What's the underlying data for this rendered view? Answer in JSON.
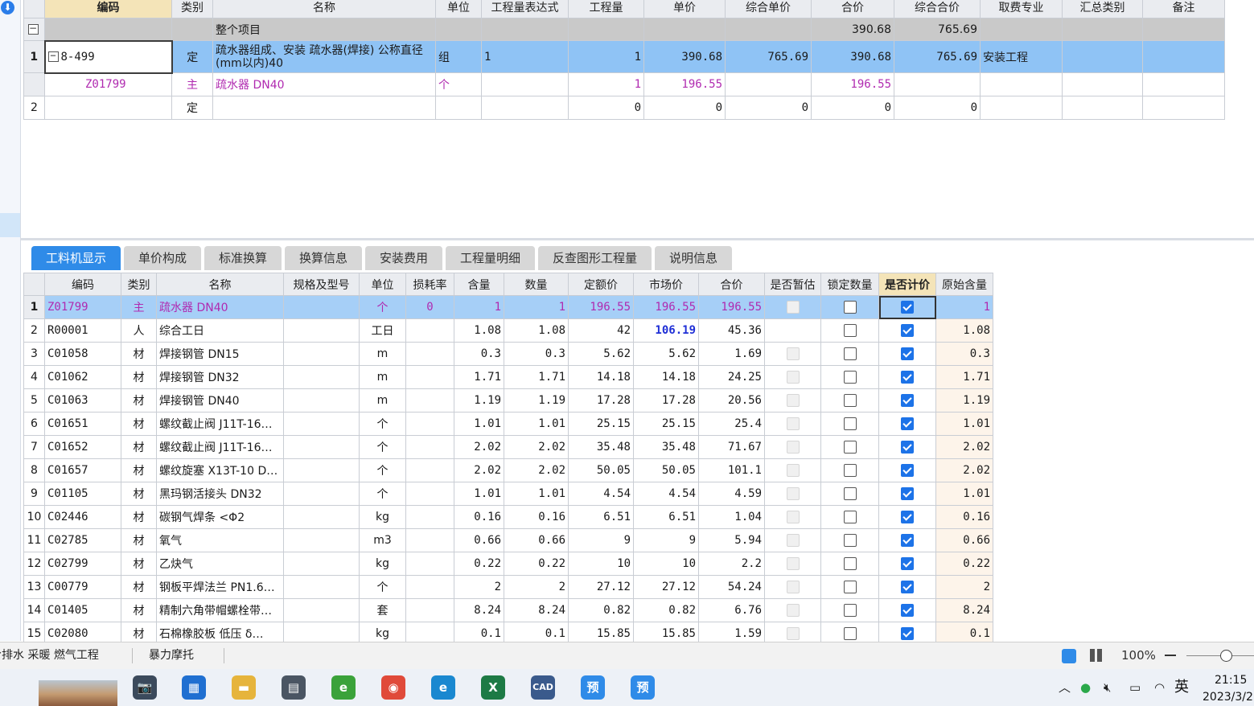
{
  "top_grid": {
    "headers": [
      "编码",
      "类别",
      "名称",
      "单位",
      "工程量表达式",
      "工程量",
      "单价",
      "综合单价",
      "合价",
      "综合合价",
      "取费专业",
      "汇总类别",
      "备注"
    ],
    "summary": {
      "tree": "−",
      "label": "整个项目",
      "hejia": "390.68",
      "zonghe_hejia": "765.69"
    },
    "rows": [
      {
        "num": "1",
        "code": "8-499",
        "type": "定",
        "name": "疏水器组成、安装 疏水器(焊接) 公称直径(mm以内)40",
        "unit": "组",
        "expr": "1",
        "qty": "1",
        "price": "390.68",
        "unit_total": "765.69",
        "total": "390.68",
        "total_all": "765.69",
        "major": "安装工程",
        "category": "",
        "remark": ""
      },
      {
        "num": "",
        "code": "Z01799",
        "type": "主",
        "name": "疏水器 DN40",
        "unit": "个",
        "expr": "",
        "qty": "1",
        "price": "196.55",
        "unit_total": "",
        "total": "196.55",
        "total_all": "",
        "major": "",
        "category": "",
        "remark": ""
      },
      {
        "num": "2",
        "code": "",
        "type": "定",
        "name": "",
        "unit": "",
        "expr": "",
        "qty": "0",
        "price": "0",
        "unit_total": "0",
        "total": "0",
        "total_all": "0",
        "major": "",
        "category": "",
        "remark": ""
      }
    ]
  },
  "tabs": [
    "工料机显示",
    "单价构成",
    "标准换算",
    "换算信息",
    "安装费用",
    "工程量明细",
    "反查图形工程量",
    "说明信息"
  ],
  "active_tab": 0,
  "bottom_grid": {
    "headers": [
      "编码",
      "类别",
      "名称",
      "规格及型号",
      "单位",
      "损耗率",
      "含量",
      "数量",
      "定额价",
      "市场价",
      "合价",
      "是否暂估",
      "锁定数量",
      "是否计价",
      "原始含量"
    ],
    "rows": [
      {
        "num": "1",
        "code": "Z01799",
        "type": "主",
        "name": "疏水器 DN40",
        "spec": "",
        "unit": "个",
        "loss": "0",
        "content": "1",
        "qty": "1",
        "quota": "196.55",
        "market": "196.55",
        "total": "196.55",
        "orig": "1"
      },
      {
        "num": "2",
        "code": "R00001",
        "type": "人",
        "name": "综合工日",
        "spec": "",
        "unit": "工日",
        "loss": "",
        "content": "1.08",
        "qty": "1.08",
        "quota": "42",
        "market": "106.19",
        "total": "45.36",
        "orig": "1.08"
      },
      {
        "num": "3",
        "code": "C01058",
        "type": "材",
        "name": "焊接钢管 DN15",
        "spec": "",
        "unit": "m",
        "loss": "",
        "content": "0.3",
        "qty": "0.3",
        "quota": "5.62",
        "market": "5.62",
        "total": "1.69",
        "orig": "0.3"
      },
      {
        "num": "4",
        "code": "C01062",
        "type": "材",
        "name": "焊接钢管 DN32",
        "spec": "",
        "unit": "m",
        "loss": "",
        "content": "1.71",
        "qty": "1.71",
        "quota": "14.18",
        "market": "14.18",
        "total": "24.25",
        "orig": "1.71"
      },
      {
        "num": "5",
        "code": "C01063",
        "type": "材",
        "name": "焊接钢管 DN40",
        "spec": "",
        "unit": "m",
        "loss": "",
        "content": "1.19",
        "qty": "1.19",
        "quota": "17.28",
        "market": "17.28",
        "total": "20.56",
        "orig": "1.19"
      },
      {
        "num": "6",
        "code": "C01651",
        "type": "材",
        "name": "螺纹截止阀 J11T-16…",
        "spec": "",
        "unit": "个",
        "loss": "",
        "content": "1.01",
        "qty": "1.01",
        "quota": "25.15",
        "market": "25.15",
        "total": "25.4",
        "orig": "1.01"
      },
      {
        "num": "7",
        "code": "C01652",
        "type": "材",
        "name": "螺纹截止阀 J11T-16…",
        "spec": "",
        "unit": "个",
        "loss": "",
        "content": "2.02",
        "qty": "2.02",
        "quota": "35.48",
        "market": "35.48",
        "total": "71.67",
        "orig": "2.02"
      },
      {
        "num": "8",
        "code": "C01657",
        "type": "材",
        "name": "螺纹旋塞 X13T-10 D…",
        "spec": "",
        "unit": "个",
        "loss": "",
        "content": "2.02",
        "qty": "2.02",
        "quota": "50.05",
        "market": "50.05",
        "total": "101.1",
        "orig": "2.02"
      },
      {
        "num": "9",
        "code": "C01105",
        "type": "材",
        "name": "黑玛钢活接头 DN32",
        "spec": "",
        "unit": "个",
        "loss": "",
        "content": "1.01",
        "qty": "1.01",
        "quota": "4.54",
        "market": "4.54",
        "total": "4.59",
        "orig": "1.01"
      },
      {
        "num": "10",
        "code": "C02446",
        "type": "材",
        "name": "碳钢气焊条 <Φ2",
        "spec": "",
        "unit": "kg",
        "loss": "",
        "content": "0.16",
        "qty": "0.16",
        "quota": "6.51",
        "market": "6.51",
        "total": "1.04",
        "orig": "0.16"
      },
      {
        "num": "11",
        "code": "C02785",
        "type": "材",
        "name": "氧气",
        "spec": "",
        "unit": "m3",
        "loss": "",
        "content": "0.66",
        "qty": "0.66",
        "quota": "9",
        "market": "9",
        "total": "5.94",
        "orig": "0.66"
      },
      {
        "num": "12",
        "code": "C02799",
        "type": "材",
        "name": "乙炔气",
        "spec": "",
        "unit": "kg",
        "loss": "",
        "content": "0.22",
        "qty": "0.22",
        "quota": "10",
        "market": "10",
        "total": "2.2",
        "orig": "0.22"
      },
      {
        "num": "13",
        "code": "C00779",
        "type": "材",
        "name": "钢板平焊法兰 PN1.6…",
        "spec": "",
        "unit": "个",
        "loss": "",
        "content": "2",
        "qty": "2",
        "quota": "27.12",
        "market": "27.12",
        "total": "54.24",
        "orig": "2"
      },
      {
        "num": "14",
        "code": "C01405",
        "type": "材",
        "name": "精制六角带帽螺栓带…",
        "spec": "",
        "unit": "套",
        "loss": "",
        "content": "8.24",
        "qty": "8.24",
        "quota": "0.82",
        "market": "0.82",
        "total": "6.76",
        "orig": "8.24"
      },
      {
        "num": "15",
        "code": "C02080",
        "type": "材",
        "name": "石棉橡胶板 低压 δ…",
        "spec": "",
        "unit": "kg",
        "loss": "",
        "content": "0.1",
        "qty": "0.1",
        "quota": "15.85",
        "market": "15.85",
        "total": "1.59",
        "orig": "0.1"
      }
    ]
  },
  "statusbar": {
    "item1": "给排水 采暖 燃气工程",
    "item2": "暴力摩托",
    "zoom": "100%"
  },
  "taskbar": {
    "apps": [
      {
        "icon": "camera-icon",
        "glyph": "📷",
        "color": "#3b4a5c"
      },
      {
        "icon": "store-icon",
        "glyph": "▦",
        "color": "#1f6fd1"
      },
      {
        "icon": "folder-icon",
        "glyph": "▬",
        "color": "#e6b43c"
      },
      {
        "icon": "calculator-icon",
        "glyph": "▤",
        "color": "#4a5563"
      },
      {
        "icon": "ie-icon",
        "glyph": "e",
        "color": "#3aa23a"
      },
      {
        "icon": "chrome-icon",
        "glyph": "◉",
        "color": "#e04a3a"
      },
      {
        "icon": "edge-icon",
        "glyph": "e",
        "color": "#1a88d0"
      },
      {
        "icon": "excel-icon",
        "glyph": "X",
        "color": "#1d7a45"
      },
      {
        "icon": "cad-icon",
        "glyph": "CAD",
        "color": "#3a5a8c"
      },
      {
        "icon": "yu-icon",
        "glyph": "预",
        "color": "#2f8be8"
      },
      {
        "icon": "yu-icon",
        "glyph": "预",
        "color": "#2f8be8"
      }
    ],
    "ime": "英",
    "time": "21:15",
    "date": "2023/3/2"
  }
}
